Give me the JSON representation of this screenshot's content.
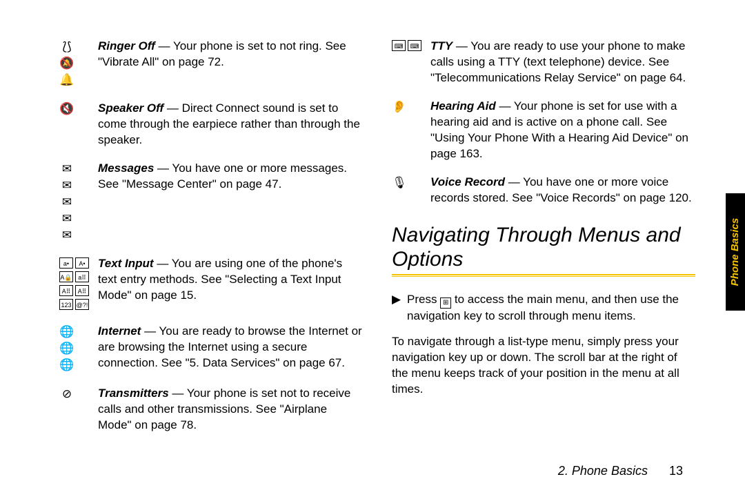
{
  "sidetab_label": "Phone Basics",
  "footer": {
    "chapter": "2. Phone Basics",
    "page": "13"
  },
  "left": [
    {
      "icons": [
        "vibrate-icon",
        "bell-mute-icon",
        "bell-outline-icon"
      ],
      "term": "Ringer Off",
      "text": " — Your phone is set to not ring. See \"Vibrate All\" on page 72."
    },
    {
      "icons": [
        "speaker-mute-icon"
      ],
      "term": "Speaker Off",
      "text": " — Direct Connect sound is set to come through the earpiece rather than through the speaker."
    },
    {
      "icons": [
        "envelope-open-icon",
        "envelope-open-icon",
        "envelope-dark-icon",
        "envelope-check-icon",
        "envelope-small-icon"
      ],
      "term": "Messages",
      "text": " — You have one or more messages. See \"Message Center\" on page 47."
    },
    {
      "icons": [
        "text-a-dot-icon",
        "text-A-dot-icon",
        "text-A-lock-icon",
        "text-a-grid-icon",
        "text-A-grid-icon",
        "text-A-grid-lock-icon",
        "text-123-icon",
        "text-sym-icon"
      ],
      "term": "Text Input",
      "text": " — You are using one of the phone's text entry methods. See \"Selecting a Text Input Mode\" on page 15."
    },
    {
      "icons": [
        "globe-icon",
        "globe-lock-icon",
        "globe-lock-small-icon"
      ],
      "term": "Internet",
      "text": " — You are ready to browse the Internet or are browsing the Internet using a secure connection. See \"5. Data Services\" on page 67."
    },
    {
      "icons": [
        "transmit-off-icon"
      ],
      "term": "Transmitters",
      "text": " — Your phone is set not to receive calls and other transmissions. See \"Airplane Mode\" on page 78."
    }
  ],
  "right": [
    {
      "icons": [
        "tty-box-icon",
        "tty-box-alt-icon"
      ],
      "term": "TTY",
      "text": " — You are ready to use your phone to make calls using a TTY (text telephone) device. See \"Telecommunications Relay Service\" on page 64."
    },
    {
      "icons": [
        "hearing-aid-icon"
      ],
      "term": "Hearing Aid",
      "text": " — Your phone is set for use with a hearing aid and is active on a phone call. See \"Using Your Phone With a Hearing Aid Device\" on page 163."
    },
    {
      "icons": [
        "voice-record-icon"
      ],
      "term": "Voice Record",
      "text": " — You have one or more voice records stored. See \"Voice Records\" on page 120."
    }
  ],
  "section_heading": "Navigating Through Menus and Options",
  "nav_bullet_pre": "Press ",
  "nav_bullet_post": " to access the main menu, and then use the navigation key to scroll through menu items.",
  "nav_para": "To navigate through a list-type menu, simply press your navigation key up or down. The scroll bar at the right of the menu keeps track of your position in the menu at all times.",
  "icon_glyphs": {
    "vibrate-icon": "⟅⟆",
    "bell-mute-icon": "🔕",
    "bell-outline-icon": "🔔",
    "speaker-mute-icon": "🔇",
    "envelope-open-icon": "✉",
    "envelope-dark-icon": "✉",
    "envelope-check-icon": "✉",
    "envelope-small-icon": "✉",
    "text-a-dot-icon": "a•",
    "text-A-dot-icon": "A•",
    "text-A-lock-icon": "A🔒",
    "text-a-grid-icon": "a⠿",
    "text-A-grid-icon": "A⠿",
    "text-A-grid-lock-icon": "A⠿",
    "text-123-icon": "123",
    "text-sym-icon": "@?!",
    "globe-icon": "🌐",
    "globe-lock-icon": "🌐",
    "globe-lock-small-icon": "🌐",
    "transmit-off-icon": "⊘",
    "tty-box-icon": "⌨",
    "tty-box-alt-icon": "⌨",
    "hearing-aid-icon": "👂",
    "voice-record-icon": "🎙",
    "menu-key-icon": "⊞"
  }
}
